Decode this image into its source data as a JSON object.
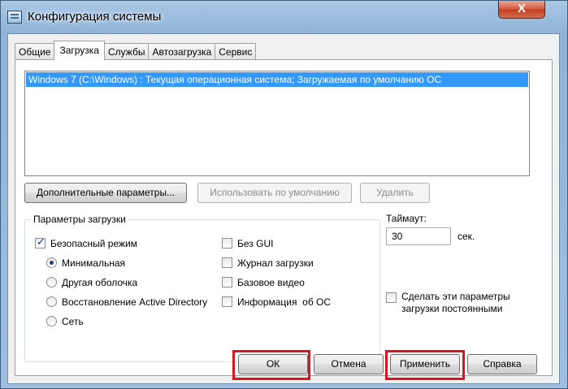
{
  "window": {
    "title": "Конфигурация системы",
    "close_label": "X"
  },
  "tabs": [
    {
      "label": "Общие"
    },
    {
      "label": "Загрузка",
      "active": true
    },
    {
      "label": "Службы"
    },
    {
      "label": "Автозагрузка"
    },
    {
      "label": "Сервис"
    }
  ],
  "boot_list": {
    "items": [
      "Windows 7 (C:\\Windows) : Текущая операционная система; Загружаемая по умолчанию ОС"
    ],
    "selected_index": 0
  },
  "list_buttons": {
    "advanced": "Дополнительные параметры...",
    "set_default": "Использовать по умолчанию",
    "delete": "Удалить"
  },
  "boot_options": {
    "group_label": "Параметры загрузки",
    "safe_mode": "Безопасный режим",
    "safe_mode_checked": true,
    "minimal": "Минимальная",
    "alternate_shell": "Другая оболочка",
    "ad_repair": "Восстановление Active Directory",
    "network": "Сеть",
    "selected_radio": "minimal",
    "no_gui": "Без GUI",
    "boot_log": "Журнал загрузки",
    "base_video": "Базовое видео",
    "os_info": "Информация  об ОС"
  },
  "timeout": {
    "label": "Таймаут:",
    "value": "30",
    "unit": "сек."
  },
  "persist": {
    "line1": "Сделать эти параметры",
    "line2": "загрузки постоянными"
  },
  "footer": {
    "ok": "ОК",
    "cancel": "Отмена",
    "apply": "Применить",
    "help": "Справка"
  },
  "colors": {
    "highlight": "#e0131d",
    "selection": "#3399ff"
  }
}
